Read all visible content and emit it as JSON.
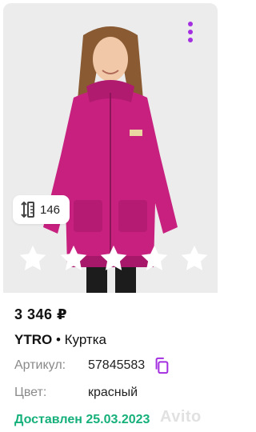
{
  "listing": {
    "size": "146",
    "price": "3 346 ₽",
    "brand": "YTRO",
    "separator": " • ",
    "category": "Куртка",
    "article_label": "Артикул:",
    "article_value": "57845583",
    "color_label": "Цвет:",
    "color_value": "красный",
    "delivery": "Доставлен 25.03.2023",
    "watermark": "Avito"
  },
  "rating": {
    "stars": 5,
    "filled": 0
  },
  "colors": {
    "accent": "#a32fe0",
    "delivery": "#16b07a",
    "jacket": "#c8207f"
  },
  "icons": [
    "more-vertical-icon",
    "ruler-size-icon",
    "star-icon",
    "copy-icon"
  ]
}
